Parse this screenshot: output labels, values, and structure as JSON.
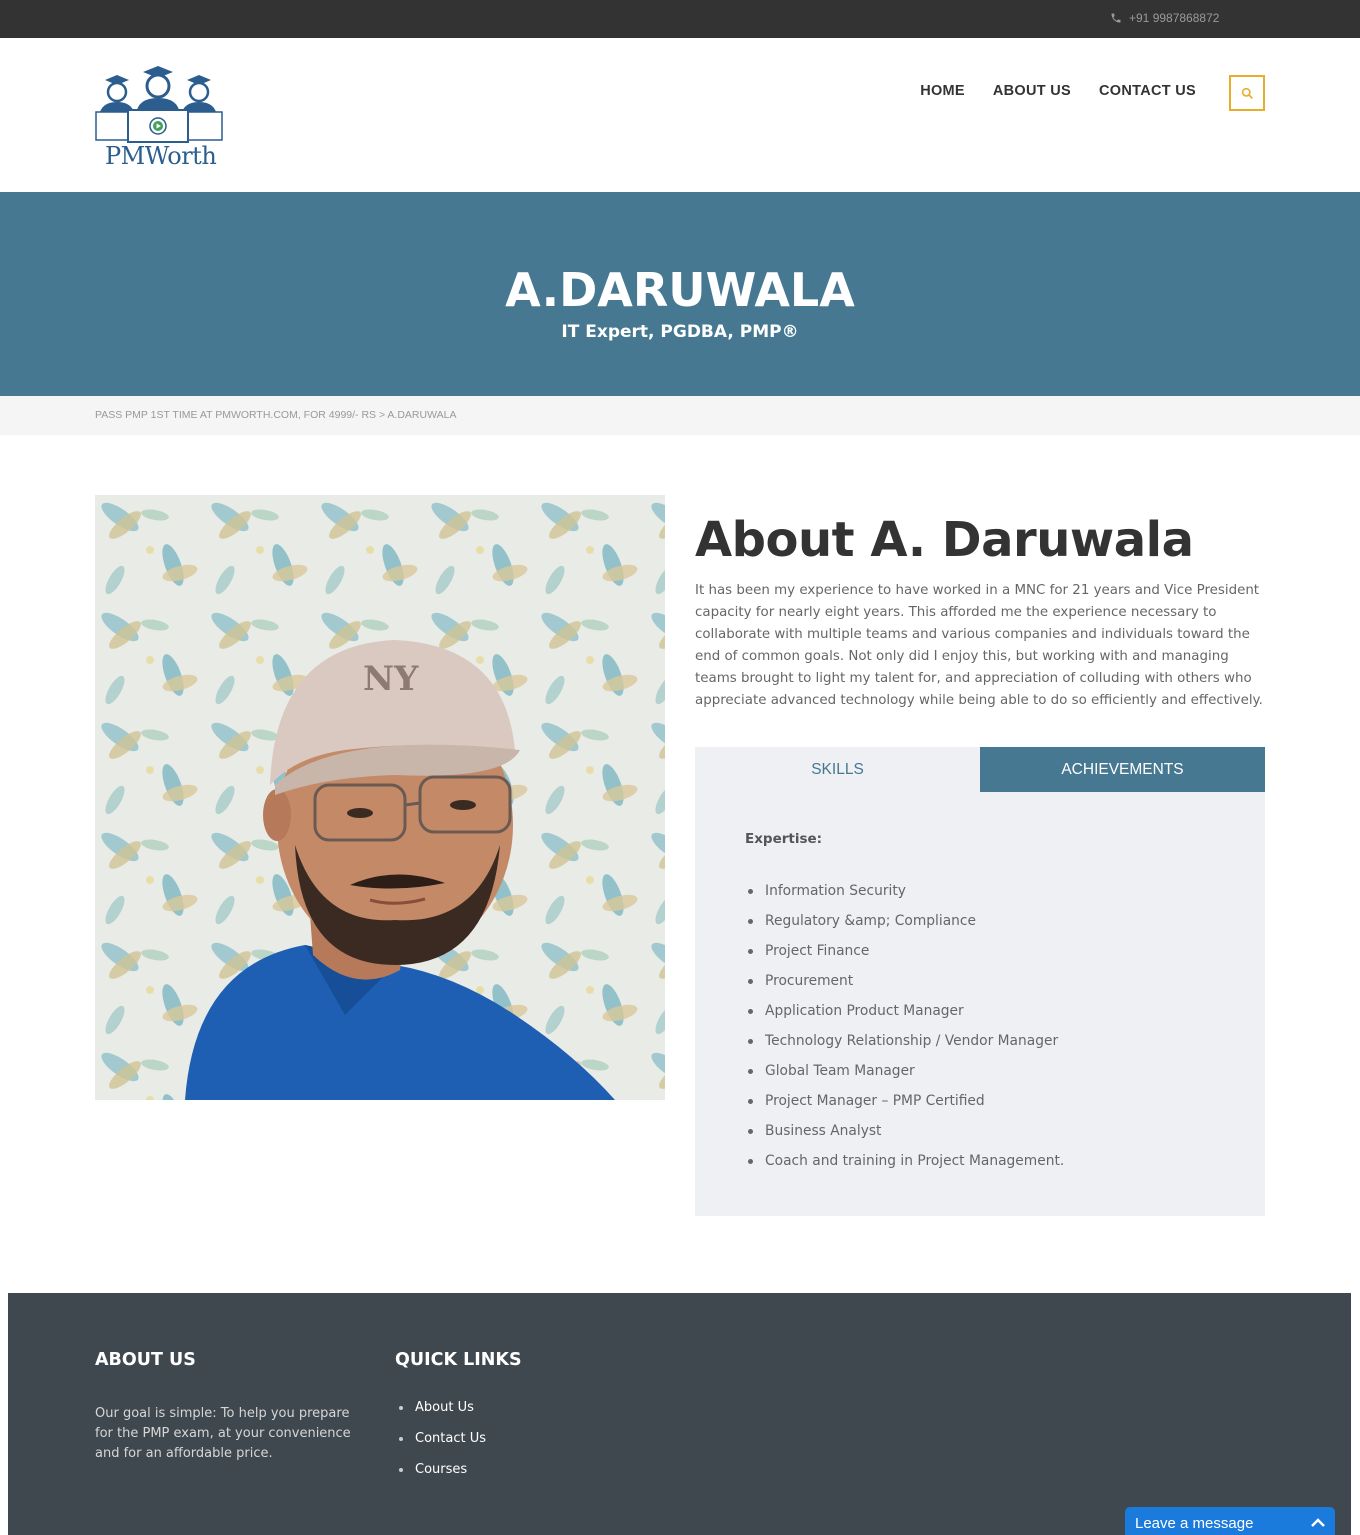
{
  "topbar": {
    "phone": "+91 9987868872",
    "phone_icon": "phone-icon"
  },
  "header": {
    "logo_text": "PMWorth",
    "nav": [
      "HOME",
      "ABOUT US",
      "CONTACT US"
    ],
    "search_icon": "search-icon"
  },
  "banner": {
    "title": "A.DARUWALA",
    "subtitle": "IT Expert, PGDBA, PMP®"
  },
  "breadcrumb": {
    "text": "PASS PMP 1ST TIME AT PMWORTH.COM, FOR 4999/- RS > A.DARUWALA"
  },
  "about": {
    "title": "About A. Daruwala",
    "text": "It has been my experience to have worked in a MNC for 21 years and Vice President capacity for nearly eight years. This afforded me the experience necessary to collaborate with multiple teams and various companies and individuals toward the end of common goals. Not only did I enjoy this, but working with and managing teams brought to light my talent for, and appreciation of colluding with others who appreciate advanced technology while being able to do so efficiently and effectively."
  },
  "tabs": {
    "skills": "SKILLS",
    "achievements": "ACHIEVEMENTS",
    "active": "SKILLS"
  },
  "skills_panel": {
    "heading": "Expertise:",
    "items": [
      "Information Security",
      "Regulatory &amp; Compliance",
      "Project Finance",
      "Procurement",
      "Application Product Manager",
      "Technology Relationship / Vendor Manager",
      "Global Team Manager",
      "Project Manager – PMP Certified",
      "Business Analyst",
      "Coach and training in Project Management."
    ]
  },
  "footer": {
    "about_title": "ABOUT US",
    "about_text": "Our goal is simple: To help you prepare for the PMP exam, at your convenience and for an affordable price.",
    "links_title": "QUICK LINKS",
    "links": [
      "About Us",
      "Contact Us",
      "Courses"
    ]
  },
  "chat": {
    "label": "Leave a message",
    "icon": "chevron-up-icon"
  },
  "colors": {
    "accent": "#467891",
    "search_border": "#e6ae2c",
    "footer_bg": "#40484f",
    "topbar_bg": "#333333",
    "chat_bg": "#1b7bdc"
  }
}
